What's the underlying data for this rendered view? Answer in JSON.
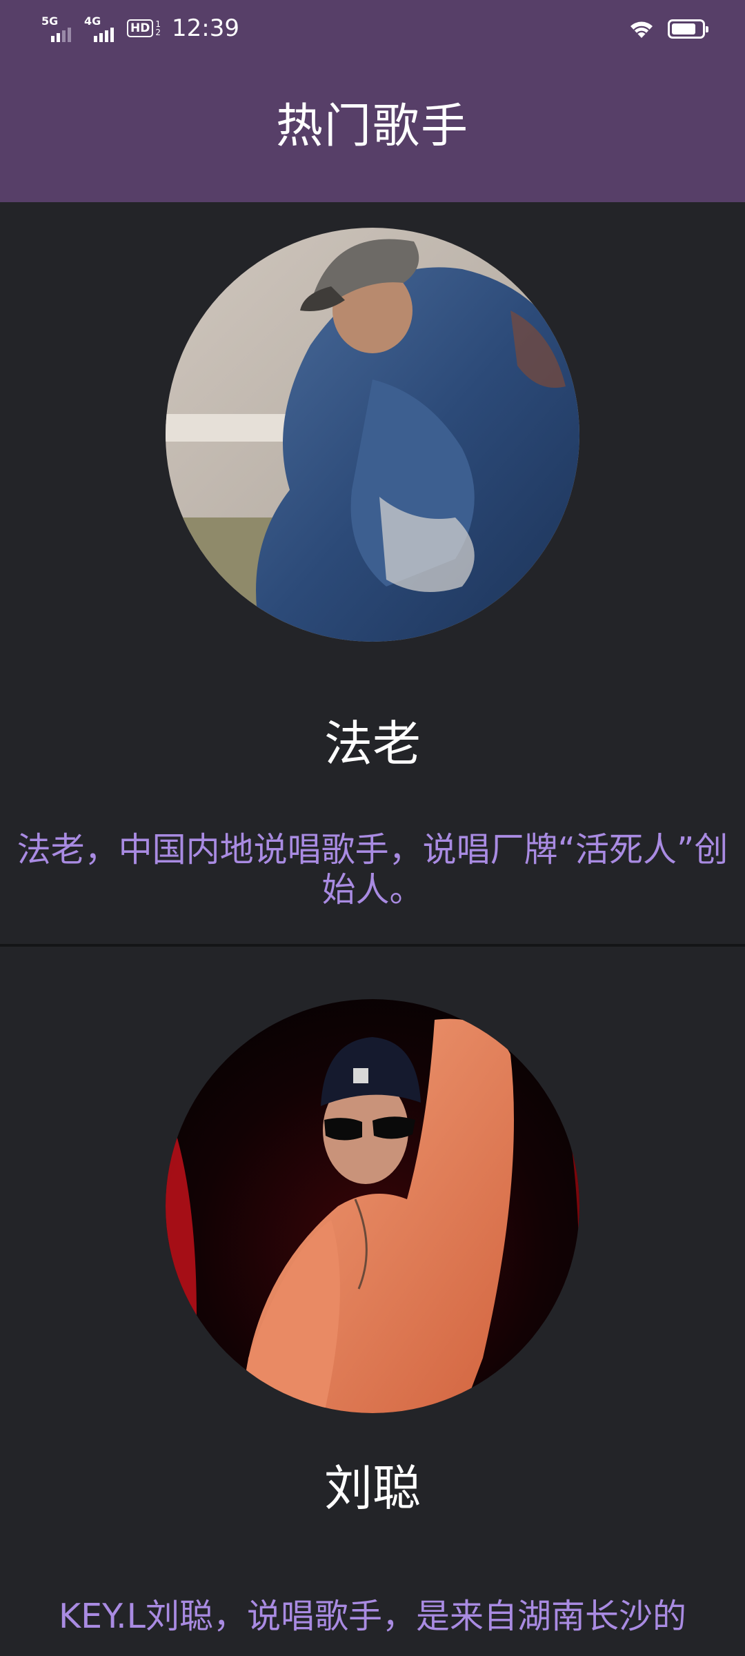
{
  "status_bar": {
    "network_1": "5G",
    "network_2": "4G",
    "hd_label": "HD",
    "hd_sub_1": "1",
    "hd_sub_2": "2",
    "time": "12:39",
    "battery_level": 0.8
  },
  "app_bar": {
    "title": "热门歌手"
  },
  "singers": [
    {
      "name": "法老",
      "description": "法老，中国内地说唱歌手，说唱厂牌“活死人”创始人。"
    },
    {
      "name": "刘聪",
      "description": "KEY.L刘聪，说唱歌手，是来自湖南长沙的"
    }
  ],
  "colors": {
    "app_bar": "#573f68",
    "background": "#232428",
    "name_text": "#ffffff",
    "description_text": "#a98be2"
  }
}
